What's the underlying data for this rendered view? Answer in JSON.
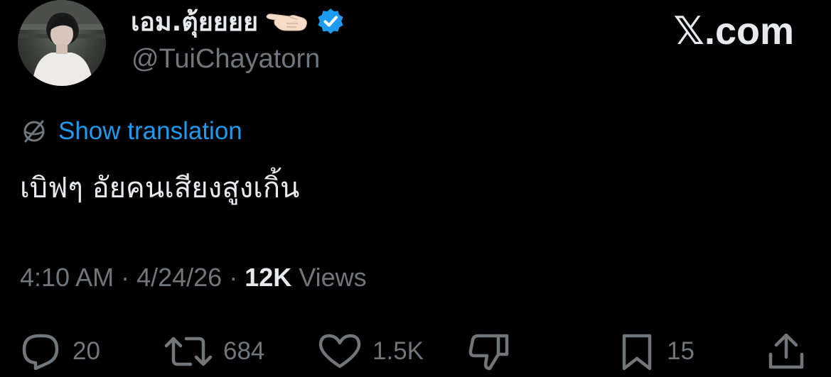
{
  "author": {
    "display_name": "เอม.ตุ้ยยยย",
    "handle": "@TuiChayatorn",
    "emoji_icon": "pointing-hand-icon",
    "verified_icon": "verified-badge-icon",
    "verified_color": "#1d9bf0"
  },
  "brand": {
    "label": "𝕏.com"
  },
  "translation": {
    "icon": "globe-slash-icon",
    "label": "Show translation",
    "color": "#1d9bf0"
  },
  "tweet": {
    "text": "เบิฟๆ อัยคนเสียงสูงเกิ้น"
  },
  "meta": {
    "time": "4:10 AM",
    "separator1": " · ",
    "date": "4/24/26",
    "separator2": " · ",
    "views_count": "12K",
    "views_label": " Views"
  },
  "actions": {
    "replies": {
      "icon": "reply-icon",
      "count": "20"
    },
    "reposts": {
      "icon": "repost-icon",
      "count": "684"
    },
    "likes": {
      "icon": "like-icon",
      "count": "1.5K"
    },
    "downvote": {
      "icon": "downvote-icon"
    },
    "bookmarks": {
      "icon": "bookmark-icon",
      "count": "15"
    },
    "share": {
      "icon": "share-icon"
    }
  },
  "colors": {
    "background": "#000000",
    "primary_text": "#e7e9ea",
    "secondary_text": "#71767b",
    "accent": "#1d9bf0"
  }
}
